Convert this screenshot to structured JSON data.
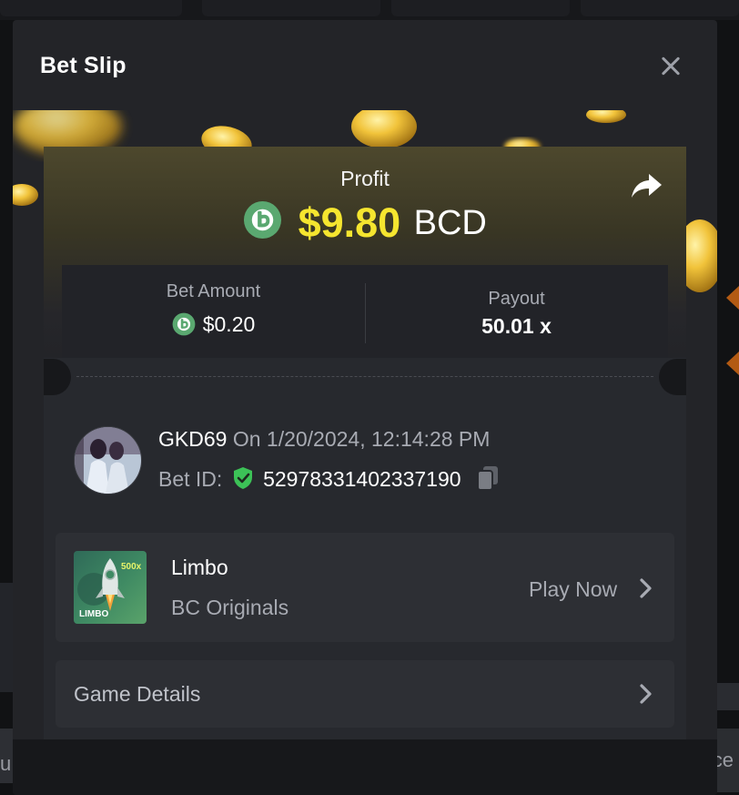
{
  "modal": {
    "title": "Bet Slip",
    "close_icon": "close-icon"
  },
  "profit": {
    "label": "Profit",
    "amount": "$9.80",
    "currency": "BCD",
    "currency_icon": "bc-coin-icon",
    "share_icon": "share-icon"
  },
  "stats": {
    "bet_amount_label": "Bet Amount",
    "bet_amount_value": "$0.20",
    "payout_label": "Payout",
    "payout_value": "50.01 x"
  },
  "bet": {
    "username": "GKD69",
    "on_date": "On 1/20/2024, 12:14:28 PM",
    "bet_id_label": "Bet ID:",
    "bet_id": "52978331402337190",
    "verified_icon": "shield-check-icon",
    "copy_icon": "copy-icon"
  },
  "game": {
    "name": "Limbo",
    "provider": "BC Originals",
    "thumb_badge": "500x",
    "thumb_label": "LIMBO",
    "cta": "Play Now"
  },
  "details": {
    "label": "Game Details"
  },
  "background": {
    "left_text": "u",
    "right_text": "ce"
  },
  "colors": {
    "profit_accent": "#f5e52f",
    "bc_coin": "#5aa870",
    "verified": "#3cc257",
    "modal_bg": "#232428",
    "card_bg": "#2d2f34"
  }
}
